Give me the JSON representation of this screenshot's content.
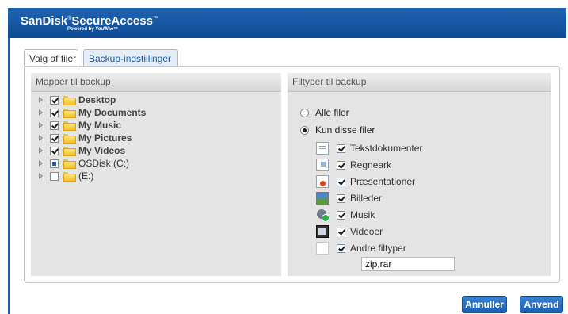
{
  "header": {
    "brand": "SanDisk",
    "brand_mark": "®",
    "product": "SecureAccess",
    "product_mark": "™",
    "powered_by": "Powered by YouWae™",
    "colors": {
      "bar": "#1556a3",
      "button": "#2a6fc0"
    }
  },
  "tabs": [
    {
      "label": "Valg af filer"
    },
    {
      "label": "Backup-indstillinger"
    }
  ],
  "left_panel": {
    "title": "Mapper til backup",
    "tree": [
      {
        "label": "Desktop",
        "state": "checked",
        "bold": true
      },
      {
        "label": "My Documents",
        "state": "checked",
        "bold": true
      },
      {
        "label": "My Music",
        "state": "checked",
        "bold": true
      },
      {
        "label": "My Pictures",
        "state": "checked",
        "bold": true
      },
      {
        "label": "My Videos",
        "state": "checked",
        "bold": true
      },
      {
        "label": "OSDisk (C:)",
        "state": "partial",
        "bold": false
      },
      {
        "label": "(E:)",
        "state": "unchecked",
        "bold": false
      }
    ]
  },
  "right_panel": {
    "title": "Filtyper til backup",
    "options": [
      {
        "label": "Alle filer",
        "selected": false
      },
      {
        "label": "Kun disse filer",
        "selected": true
      }
    ],
    "file_types": [
      {
        "label": "Tekstdokumenter",
        "icon": "text-document-icon",
        "checked": true
      },
      {
        "label": "Regneark",
        "icon": "spreadsheet-icon",
        "checked": true
      },
      {
        "label": "Præsentationer",
        "icon": "presentation-icon",
        "checked": true
      },
      {
        "label": "Billeder",
        "icon": "image-icon",
        "checked": true
      },
      {
        "label": "Musik",
        "icon": "music-icon",
        "checked": true
      },
      {
        "label": "Videoer",
        "icon": "video-icon",
        "checked": true
      },
      {
        "label": "Andre filtyper",
        "icon": "blank-file-icon",
        "checked": true
      }
    ],
    "other_extensions_value": "zip,rar"
  },
  "buttons": {
    "cancel": "Annuller",
    "apply": "Anvend"
  }
}
